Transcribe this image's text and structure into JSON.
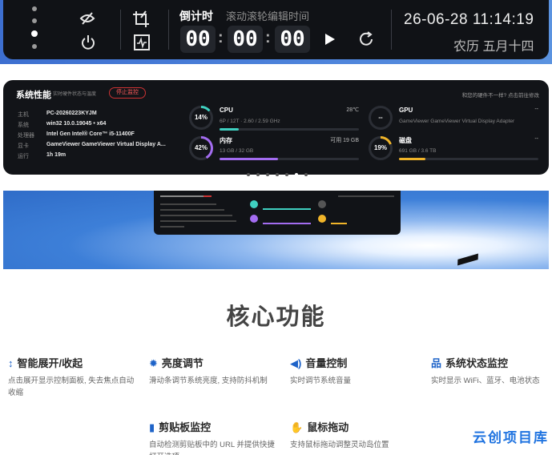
{
  "timer_bar": {
    "title": "倒计时",
    "hint": "滚动滚轮编辑时间",
    "hours": "00",
    "minutes": "00",
    "seconds": "00",
    "colon": ":",
    "date_time": "26-06-28 11:14:19",
    "lunar_date": "农历 五月十四"
  },
  "perf": {
    "title": "系统性能",
    "subtitle": "实时硬件状态与温度",
    "stop_label": "停止监控",
    "top_right_link": "和您的硬件不一样? 点击前往修改",
    "info": [
      {
        "label": "主机",
        "value": "PC-20260223KYJM"
      },
      {
        "label": "系统",
        "value": "win32 10.0.19045 • x64"
      },
      {
        "label": "处理器",
        "value": "Intel Gen Intel® Core™ i5-11400F"
      },
      {
        "label": "显卡",
        "value": "GameViewer GameViewer Virtual Display A..."
      },
      {
        "label": "运行",
        "value": "1h 19m"
      }
    ],
    "cpu": {
      "percent": "14%",
      "name": "CPU",
      "temp": "28℃",
      "detail": "6P / 12T · 2.60 / 2.59 GHz",
      "fill": 0.14
    },
    "memory": {
      "percent": "42%",
      "name": "内存",
      "available": "可用 19 GB",
      "detail": "13 GB / 32 GB",
      "fill": 0.42
    },
    "gpu": {
      "percent": "--",
      "name": "GPU",
      "temp": "--",
      "detail": "GameViewer GameViewer Virtual Display Adapter"
    },
    "disk": {
      "percent": "19%",
      "name": "磁盘",
      "right": "--",
      "detail": "691 GB / 3.6 TB",
      "fill": 0.19
    },
    "page_count": 7,
    "active_page": 6
  },
  "core": {
    "title": "核心功能",
    "features": [
      {
        "icon": "expand-icon",
        "title": "智能展开/收起",
        "desc": "点击展开显示控制面板, 失去焦点自动收缩"
      },
      {
        "icon": "sun-icon",
        "title": "亮度调节",
        "desc": "滑动条调节系统亮度, 支持防抖机制"
      },
      {
        "icon": "speaker-icon",
        "title": "音量控制",
        "desc": "实时调节系统音量"
      },
      {
        "icon": "network-icon",
        "title": "系统状态监控",
        "desc": "实时显示 WiFi、蓝牙、电池状态"
      },
      {
        "icon": "clipboard-icon",
        "title": "剪贴板监控",
        "desc": "自动检测剪贴板中的 URL 并提供快捷打开选项"
      },
      {
        "icon": "hand-icon",
        "title": "鼠标拖动",
        "desc": "支持鼠标拖动调整灵动岛位置"
      }
    ]
  },
  "watermark": "云创项目库",
  "colors": {
    "accent": "#1e63c8",
    "cpu_ring": "#3fd0c0",
    "mem_ring": "#a36cf0",
    "disk_ring": "#f0b429",
    "stop_red": "#ff5a5a"
  }
}
